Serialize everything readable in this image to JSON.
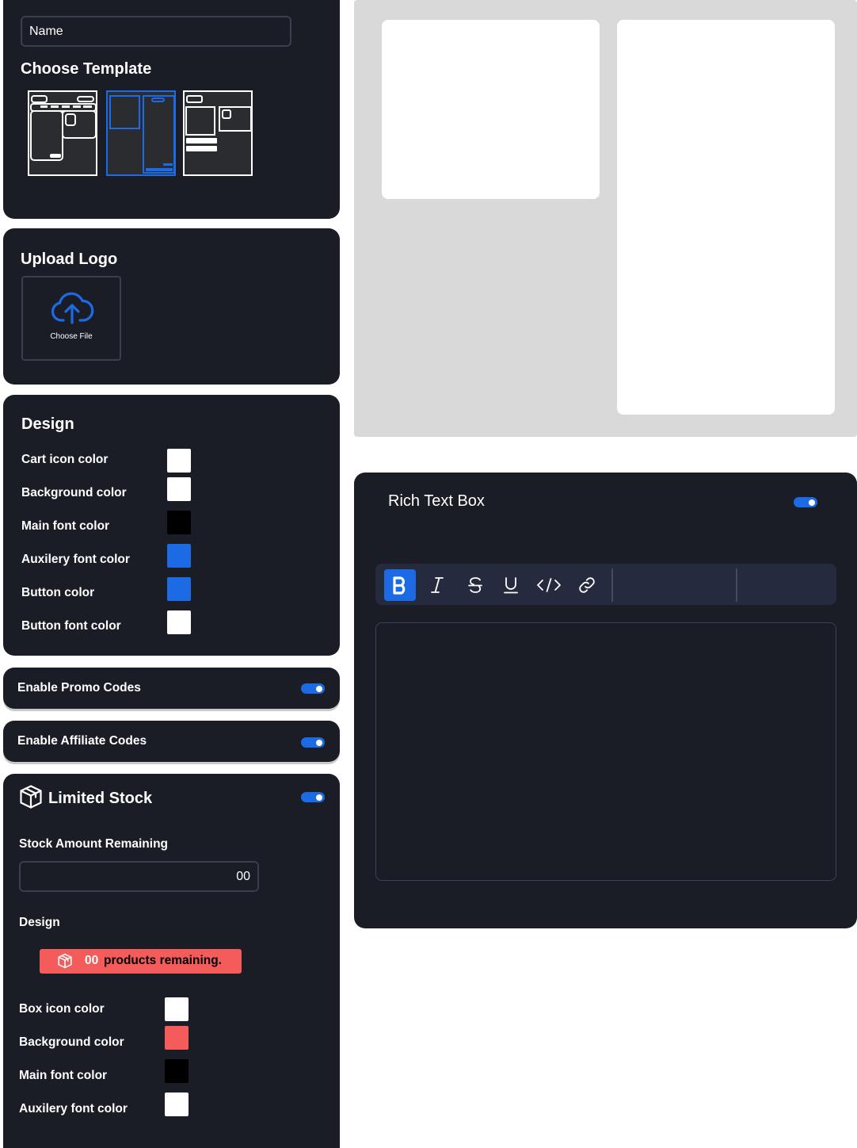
{
  "name_field": {
    "placeholder": "Name"
  },
  "template_section": {
    "title": "Choose Template",
    "templates": [
      {
        "id": "template-1",
        "selected": false
      },
      {
        "id": "template-2",
        "selected": true
      },
      {
        "id": "template-3",
        "selected": false
      }
    ]
  },
  "upload_logo": {
    "title": "Upload Logo",
    "button_label": "Choose File",
    "icon": "cloud-upload-icon"
  },
  "design": {
    "title": "Design",
    "rows": [
      {
        "label": "Cart icon color",
        "color": "#ffffff"
      },
      {
        "label": "Background color",
        "color": "#ffffff"
      },
      {
        "label": "Main font color",
        "color": "#000000"
      },
      {
        "label": "Auxilery font color",
        "color": "#1d6ae5"
      },
      {
        "label": "Button color",
        "color": "#1d6ae5"
      },
      {
        "label": "Button font color",
        "color": "#ffffff"
      }
    ]
  },
  "promo_codes": {
    "label": "Enable Promo Codes",
    "enabled": true
  },
  "affiliate_codes": {
    "label": "Enable Affiliate Codes",
    "enabled": true
  },
  "limited_stock": {
    "title": "Limited Stock",
    "icon": "box-icon",
    "enabled": true,
    "stock_label": "Stock Amount Remaining",
    "stock_value": "00",
    "design_label": "Design",
    "badge": {
      "count": "00",
      "text": "products remaining.",
      "icon": "box-icon"
    },
    "rows": [
      {
        "label": "Box icon color",
        "color": "#ffffff"
      },
      {
        "label": "Background color",
        "color": "#f45b5b"
      },
      {
        "label": "Main font color",
        "color": "#000000"
      },
      {
        "label": "Auxilery font color",
        "color": "#ffffff"
      }
    ]
  },
  "rich_text": {
    "title": "Rich Text Box",
    "enabled": true,
    "toolbar": [
      "bold-icon",
      "italic-icon",
      "strikethrough-icon",
      "underline-icon",
      "code-icon",
      "link-icon"
    ],
    "active_tool": "bold-icon"
  },
  "colors": {
    "accent": "#1d6ae5",
    "card": "#1b1d26",
    "danger": "#f45b5b"
  }
}
